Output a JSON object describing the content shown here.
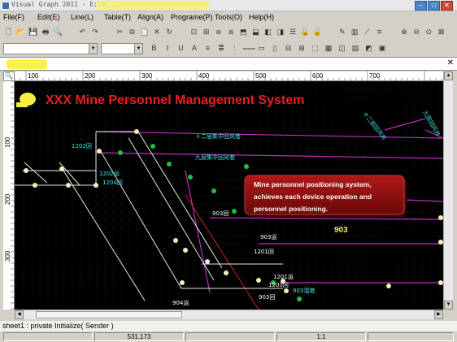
{
  "window": {
    "title": "Visual Graph 2011 - E:\\V...",
    "min_glyph": "–",
    "max_glyph": "□",
    "close_glyph": "✕"
  },
  "menu": [
    "File(F)",
    "Edit(E)",
    "Line(L)",
    "Table(T)",
    "Align(A)",
    "Programe(P)",
    "Tools(O)",
    "Help(H)"
  ],
  "toolbar1_icons": [
    "new-icon",
    "open-icon",
    "save-icon",
    "print-icon",
    "preview-icon",
    "undo-icon",
    "redo-icon",
    "cut-icon",
    "copy-icon",
    "paste-icon",
    "delete-icon",
    "history-icon",
    "copy-format-icon",
    "paste-format-icon",
    "group-icon",
    "ungroup-icon",
    "front-icon",
    "back-icon",
    "bring-forward-icon",
    "send-backward-icon",
    "layers-icon",
    "lock-icon",
    "unlock-icon",
    "pen-icon",
    "fill-icon",
    "line-color-icon",
    "line-style-icon",
    "zoom-in-icon",
    "zoom-out-icon",
    "zoom-fit-icon",
    "zoom-page-icon"
  ],
  "toolbar1_glyphs": [
    "🗋",
    "📂",
    "💾",
    "🖶",
    "🔍",
    "↶",
    "↷",
    "✂",
    "⧉",
    "📋",
    "✕",
    "↻",
    "⊡",
    "⊞",
    "⧈",
    "⧇",
    "⬒",
    "⬓",
    "◧",
    "◨",
    "☰",
    "🔒",
    "🔓",
    "✎",
    "▥",
    "⟋",
    "≡",
    "⊕",
    "⊖",
    "⊙",
    "⊠"
  ],
  "toolbar2_glyphs": [
    "B",
    "I",
    "U",
    "A",
    "≡",
    "≣",
    "⫶",
    "⩶",
    "▭",
    "▯",
    "⊟",
    "⊞",
    "⬚",
    "▦",
    "◫",
    "▤",
    "◩",
    "▣"
  ],
  "ruler": {
    "h_ticks": [
      "100",
      "200",
      "300",
      "400",
      "500",
      "600",
      "700"
    ],
    "v_ticks": [
      "100",
      "200",
      "300"
    ]
  },
  "canvas": {
    "title": "XXX Mine Personnel Management System",
    "callout_lines": [
      "Mine personnel positioning system,",
      "achieves each device operation and",
      "personnel positioning."
    ],
    "highlight_number": "903",
    "labels": [
      "十二层集中回风巷",
      "九层集中回风巷",
      "1202回",
      "1202运",
      "1204回",
      "903回",
      "903运",
      "1201回",
      "1201运",
      "1203回",
      "903溜巷",
      "904运",
      "903回",
      "十二层回风井",
      "九层回风井"
    ]
  },
  "console": "sheet1 : private Initialize( Sender )",
  "status": {
    "coords": "531,173",
    "zoom": "1:1"
  },
  "colors": {
    "title_red": "#e82020",
    "label_cyan": "#40e8e8",
    "callout_bg": "#8a1010",
    "line_magenta": "#c030c0",
    "node_green": "#20c040",
    "node_cream": "#f0f0c0"
  }
}
